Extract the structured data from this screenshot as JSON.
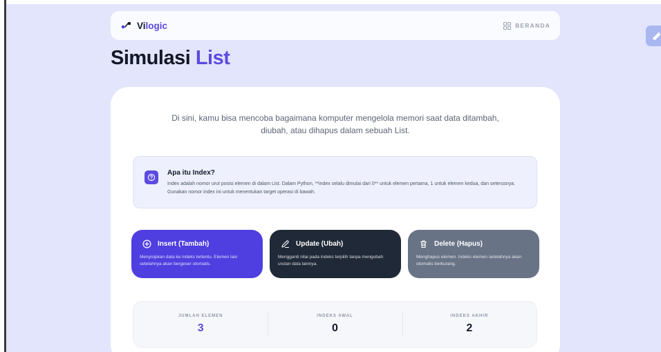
{
  "navbar": {
    "brand_prefix": "Vi",
    "brand_accent": "logic",
    "home_label": "BERANDA"
  },
  "page": {
    "title_main": "Simulasi",
    "title_accent": "List"
  },
  "intro": {
    "line1": "Di sini, kamu bisa mencoba bagaimana komputer mengelola memori saat data ditambah,",
    "line2": "diubah, atau dihapus dalam sebuah List."
  },
  "info": {
    "title": "Apa itu Index?",
    "text": "Index adalah nomor urut posisi elemen di dalam List. Dalam Python, **index selalu dimulai dari 0** untuk elemen pertama, 1 untuk elemen kedua, dan seterusnya. Gunakan nomor index ini untuk menentukan target operasi di bawah."
  },
  "actions": {
    "insert": {
      "title": "Insert (Tambah)",
      "desc": "Menyisipkan data ke indeks tertentu. Elemen lain setelahnya akan bergeser otomatis."
    },
    "update": {
      "title": "Update (Ubah)",
      "desc": "Mengganti nilai pada indeks terpilih tanpa mengubah urutan data lainnya."
    },
    "delete": {
      "title": "Delete (Hapus)",
      "desc": "Menghapus elemen. Indeks elemen setelahnya akan otomatis berkurang."
    }
  },
  "stats": {
    "count": {
      "label": "JUMLAH ELEMEN",
      "value": "3"
    },
    "first_index": {
      "label": "INDEKS AWAL",
      "value": "0"
    },
    "last_index": {
      "label": "INDEKS AKHIR",
      "value": "2"
    }
  },
  "colors": {
    "accent": "#5b4ae0",
    "background": "#e2e5fb",
    "insert": "#4f3fe0",
    "update": "#1f2937",
    "delete": "#697386"
  },
  "icons": {
    "brand": "vilogic-logo-icon",
    "home": "grid-icon",
    "info": "question-circle-icon",
    "insert": "plus-circle-icon",
    "update": "pencil-icon",
    "delete": "trash-icon",
    "floating": "lightning-icon"
  }
}
